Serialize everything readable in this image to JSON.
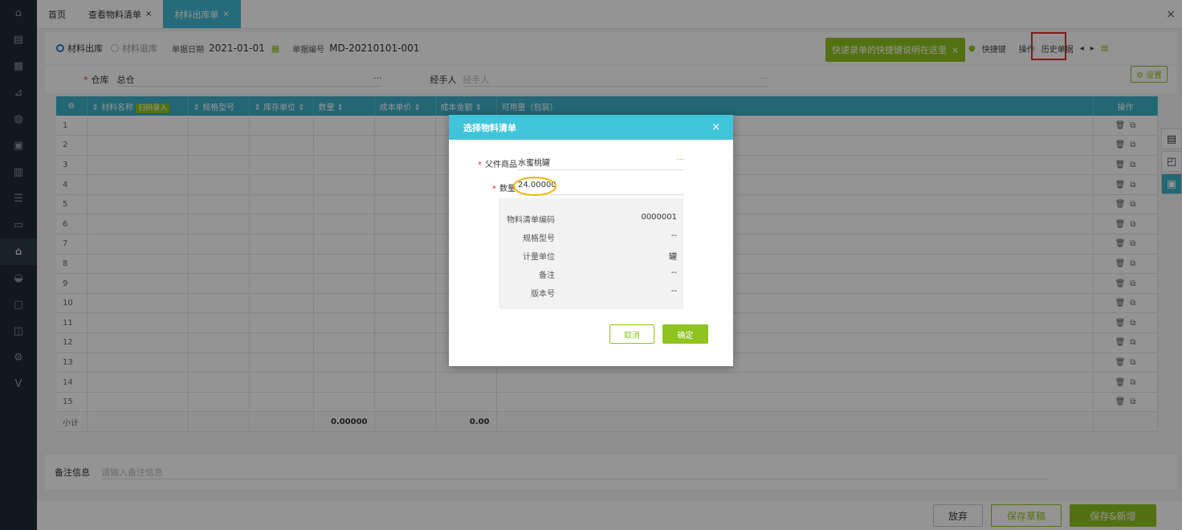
{
  "tabs": [
    {
      "label": "首页",
      "closable": false
    },
    {
      "label": "查看物料清单",
      "closable": true
    },
    {
      "label": "材料出库单",
      "closable": true
    }
  ],
  "close_glyph": "×",
  "sidebar_icons": [
    "home-icon",
    "doc-icon",
    "list-icon",
    "chart-icon",
    "bag-icon",
    "file-icon",
    "report-icon",
    "store-icon",
    "wallet-icon",
    "warehouse-icon",
    "cake-icon",
    "settle-icon",
    "box-icon",
    "gear-icon",
    "v-icon"
  ],
  "toolbar": {
    "radio_out": "材料出库",
    "radio_return": "材料退库",
    "date_label": "单据日期",
    "date_value": "2021-01-01",
    "no_label": "单据编号",
    "no_value": "MD-20210101-001",
    "tip_text": "快速录单的快捷键说明在这里",
    "shortcut_label": "快捷键",
    "operate_label": "操作",
    "history_label": "历史单据"
  },
  "form": {
    "warehouse_label": "仓库",
    "warehouse_value": "总仓",
    "handler_label": "经手人",
    "handler_placeholder": "经手人",
    "dots": "···",
    "settings_label": "设置"
  },
  "table": {
    "headers": [
      "材料名称",
      "扫码录入",
      "规格型号",
      "库存单位",
      "数量",
      "成本单价",
      "成本金额",
      "可用量（包装）",
      "操作"
    ],
    "rows": [
      "1",
      "2",
      "3",
      "4",
      "5",
      "6",
      "7",
      "8",
      "9",
      "10",
      "11",
      "12",
      "13",
      "14",
      "15"
    ],
    "subtotal_label": "小计",
    "subtotal_qty": "0.00000",
    "subtotal_amount": "0.00"
  },
  "remark": {
    "label": "备注信息",
    "placeholder": "请输入备注信息"
  },
  "footer": {
    "discard": "放弃",
    "save_draft": "保存草稿",
    "save_new": "保存&新增"
  },
  "modal": {
    "title": "选择物料清单",
    "parent_label": "父件商品",
    "parent_value": "水蜜桃罐",
    "qty_label": "数量",
    "qty_value": "24.00000",
    "info": [
      {
        "k": "物料清单编码",
        "v": "0000001"
      },
      {
        "k": "规格型号",
        "v": "--"
      },
      {
        "k": "计量单位",
        "v": "罐"
      },
      {
        "k": "备注",
        "v": "--"
      },
      {
        "k": "版本号",
        "v": "--"
      }
    ],
    "cancel": "取消",
    "confirm": "确定"
  },
  "colors": {
    "accent": "#8fc31f",
    "header": "#3db0c8",
    "highlight": "#e52b2b",
    "ring": "#f0b400"
  }
}
